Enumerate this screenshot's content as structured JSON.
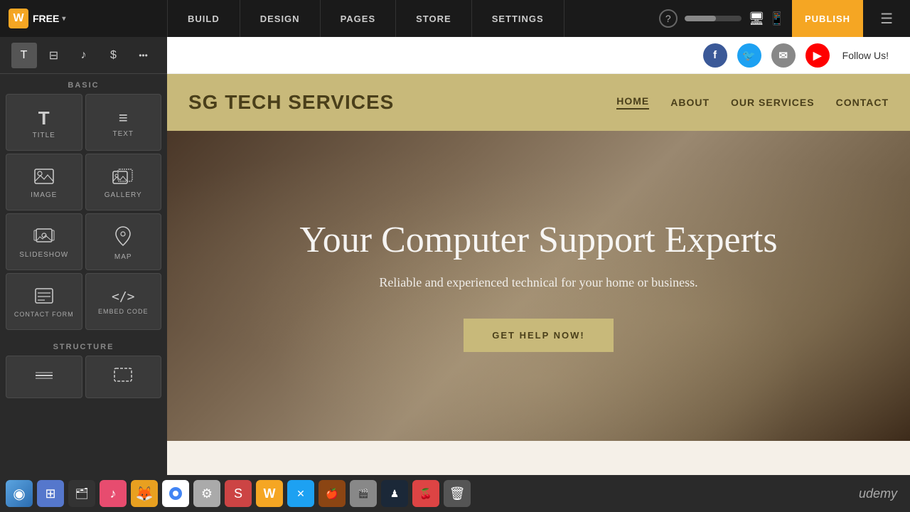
{
  "topbar": {
    "logo": "W",
    "free_label": "FREE",
    "nav_items": [
      "BUILD",
      "DESIGN",
      "PAGES",
      "STORE",
      "SETTINGS"
    ],
    "follow_us": "Follow Us!",
    "publish_label": "PUBLISH"
  },
  "sidebar": {
    "basic_label": "BASIC",
    "structure_label": "STRUCTURE",
    "items_basic": [
      {
        "id": "title",
        "label": "TITLE",
        "icon": "T"
      },
      {
        "id": "text",
        "label": "TEXT",
        "icon": "≡"
      },
      {
        "id": "image",
        "label": "IMAGE",
        "icon": "🖼"
      },
      {
        "id": "gallery",
        "label": "GALLERY",
        "icon": "🖼"
      },
      {
        "id": "slideshow",
        "label": "SLIDESHOW",
        "icon": "⊞"
      },
      {
        "id": "map",
        "label": "MAP",
        "icon": "📍"
      },
      {
        "id": "contact-form",
        "label": "CONTACT FORM",
        "icon": "☰"
      },
      {
        "id": "embed-code",
        "label": "EMBED CODE",
        "icon": "</>"
      }
    ],
    "items_structure": [
      {
        "id": "divider",
        "label": "",
        "icon": "⊟"
      },
      {
        "id": "container",
        "label": "",
        "icon": "⊡"
      }
    ]
  },
  "website": {
    "logo": "SG TECH SERVICES",
    "nav_items": [
      "HOME",
      "ABOUT",
      "OUR SERVICES",
      "CONTACT"
    ],
    "follow_us": "Follow Us!",
    "hero_title": "Your Computer Support Experts",
    "hero_subtitle": "Reliable and experienced technical for your home or business.",
    "hero_button": "GET HELP NOW!"
  }
}
